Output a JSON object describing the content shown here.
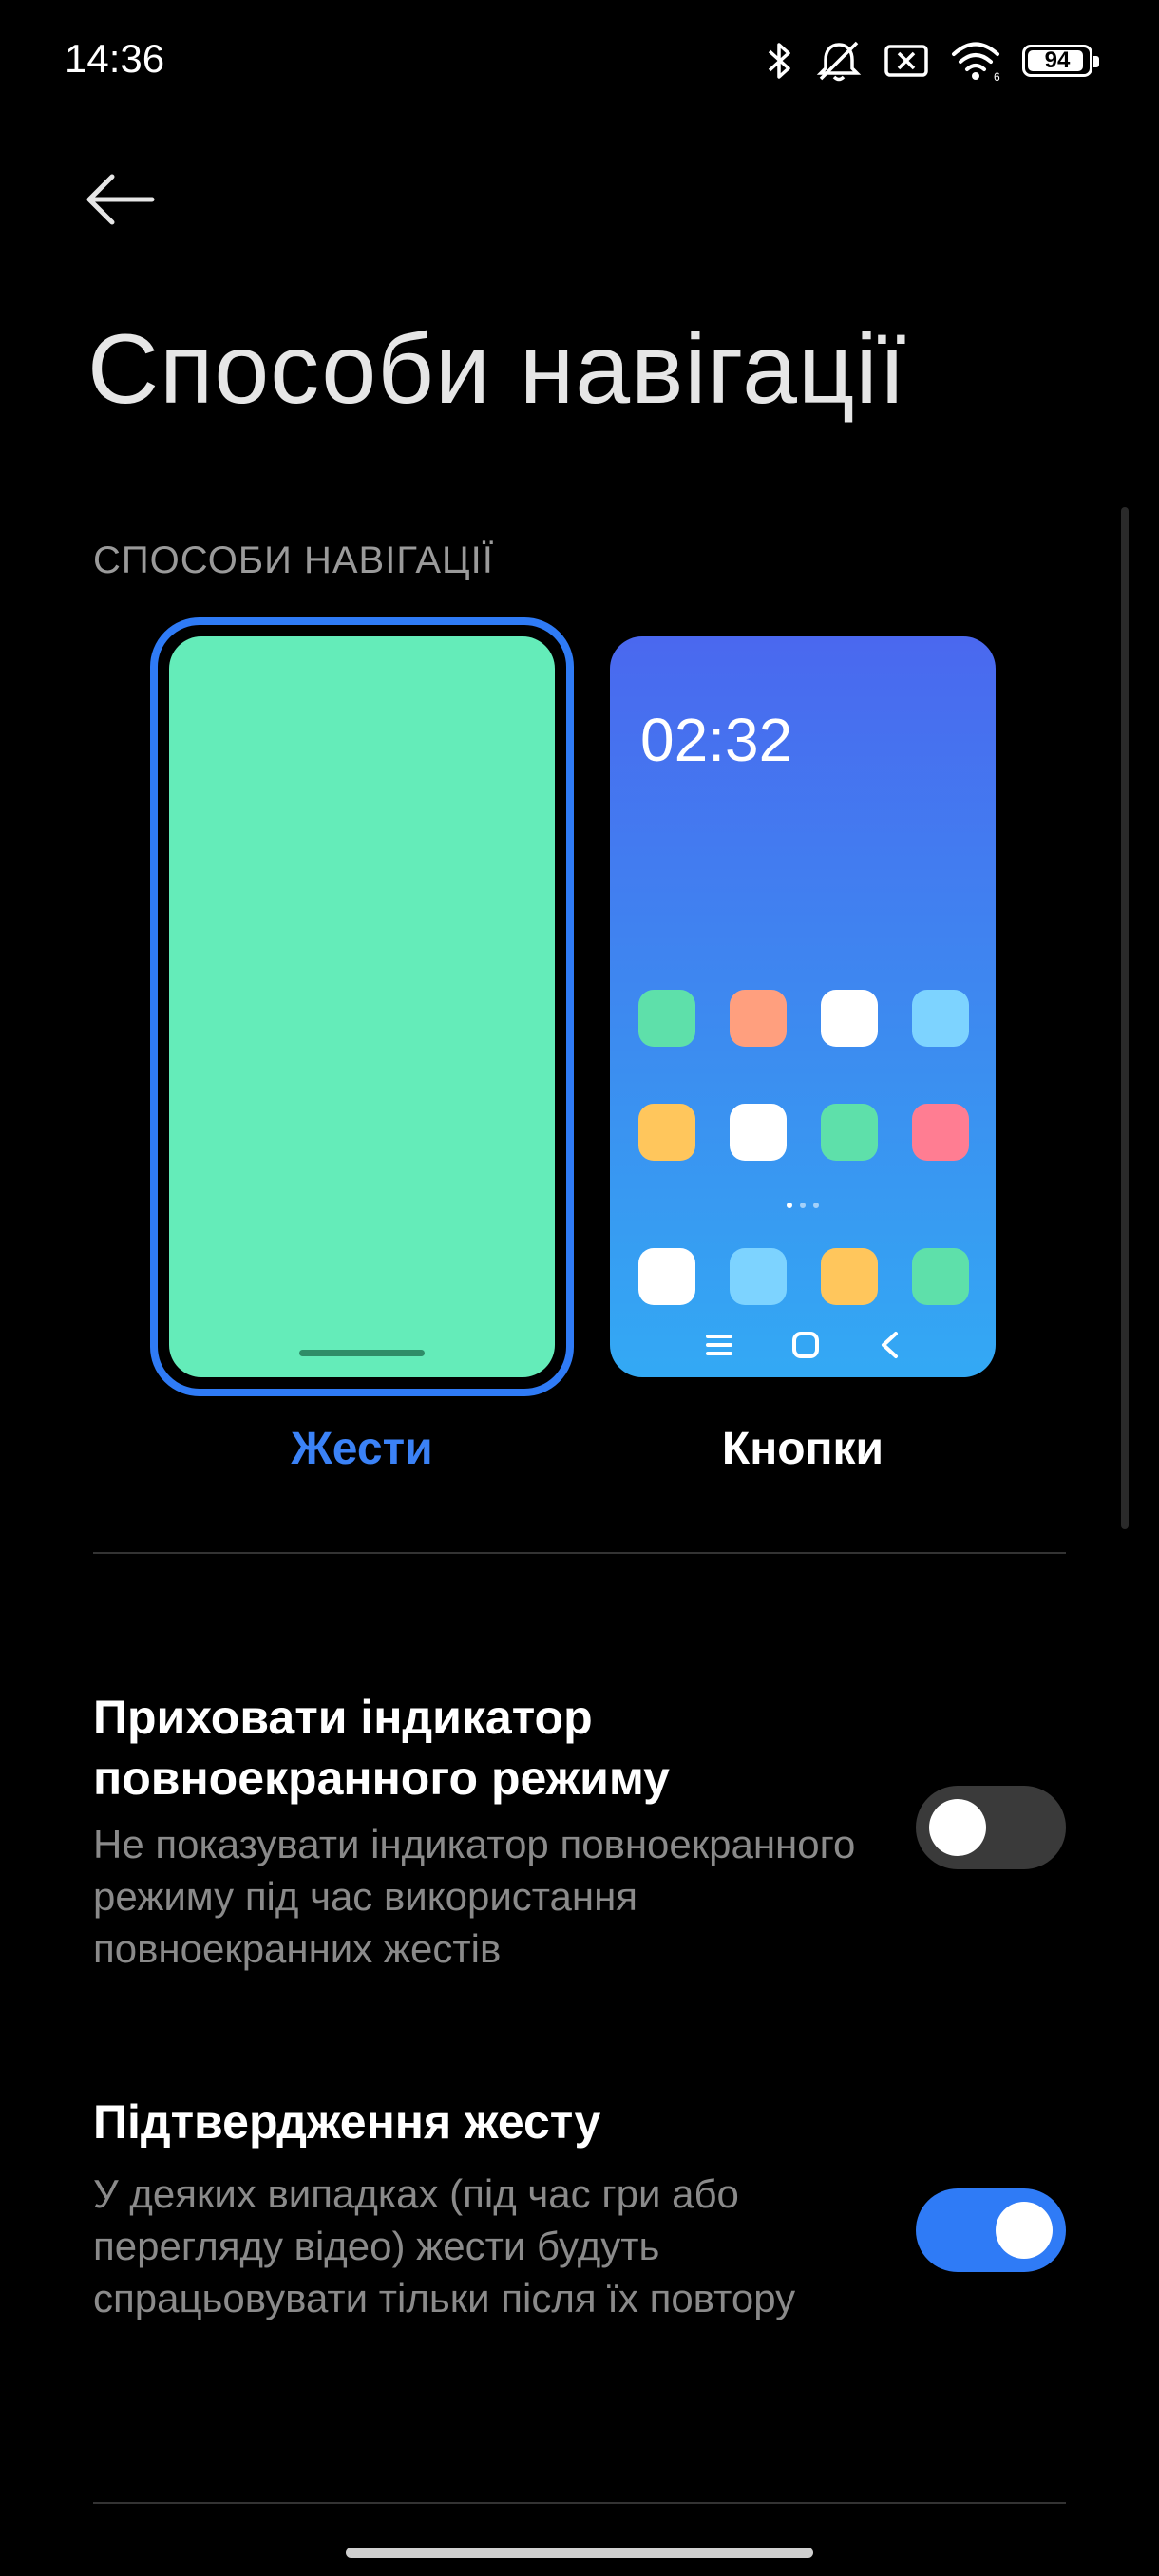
{
  "status_bar": {
    "time": "14:36",
    "battery_level": "94",
    "icons": [
      "bluetooth-icon",
      "muted-bell-icon",
      "sim-error-icon",
      "wifi-icon",
      "battery-icon"
    ]
  },
  "page": {
    "title": "Способи навігації",
    "section_header": "СПОСОБИ НАВІГАЦІЇ"
  },
  "options": [
    {
      "label": "Жести",
      "selected": true
    },
    {
      "label": "Кнопки",
      "selected": false,
      "preview_time": "02:32"
    }
  ],
  "settings": [
    {
      "title": "Приховати індикатор повноекранного режиму",
      "description": "Не показувати індикатор повноекранного режиму під час використання повноекранних жестів",
      "enabled": false
    },
    {
      "title": "Підтвердження жесту",
      "description": "У деяких випадках (під час гри або перегляду відео) жести будуть спрацьовувати тільки після їх повтору",
      "enabled": true
    }
  ],
  "colors": {
    "accent": "#2f7bf6",
    "gesture_preview": "#64ecb9",
    "background": "#000000"
  },
  "preview_app_colors": [
    "#5ee0aa",
    "#ff9f7e",
    "#ffffff",
    "#7dd3ff",
    "#ffc65c",
    "#ffffff",
    "#5ee0aa",
    "#ff7d92",
    "#ffffff",
    "#7dd3ff",
    "#ffc65c",
    "#5ee0aa"
  ]
}
